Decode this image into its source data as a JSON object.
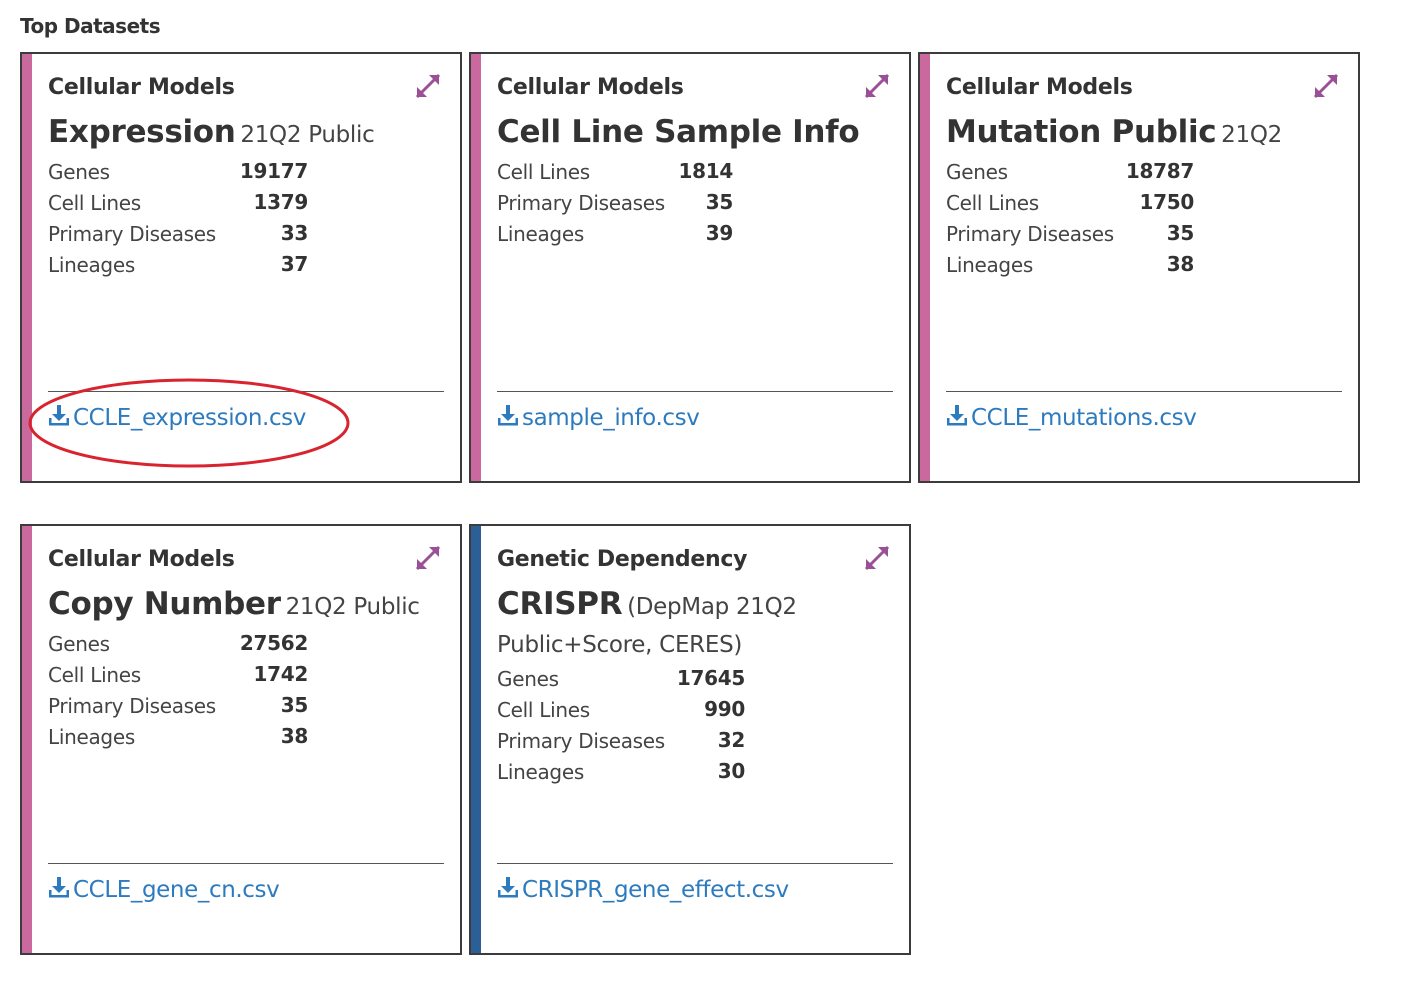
{
  "section_title": "Top Datasets",
  "colors": {
    "cellular_accent": "#c9699e",
    "genetic_accent": "#2c5f96",
    "link": "#2d7bbf",
    "expand_icon": "#9b4f96",
    "highlight": "#d9242f"
  },
  "cards": [
    {
      "category": "Cellular Models",
      "name": "Expression",
      "subtitle": "21Q2 Public",
      "stats": [
        {
          "label": "Genes",
          "value": "19177"
        },
        {
          "label": "Cell Lines",
          "value": "1379"
        },
        {
          "label": "Primary Diseases",
          "value": "33"
        },
        {
          "label": "Lineages",
          "value": "37"
        }
      ],
      "file": "CCLE_expression.csv",
      "highlighted": true
    },
    {
      "category": "Cellular Models",
      "name": "Cell Line Sample Info",
      "subtitle": "",
      "stats": [
        {
          "label": "Cell Lines",
          "value": "1814"
        },
        {
          "label": "Primary Diseases",
          "value": "35"
        },
        {
          "label": "Lineages",
          "value": "39"
        }
      ],
      "file": "sample_info.csv"
    },
    {
      "category": "Cellular Models",
      "name": "Mutation Public",
      "subtitle": "21Q2",
      "stats": [
        {
          "label": "Genes",
          "value": "18787"
        },
        {
          "label": "Cell Lines",
          "value": "1750"
        },
        {
          "label": "Primary Diseases",
          "value": "35"
        },
        {
          "label": "Lineages",
          "value": "38"
        }
      ],
      "file": "CCLE_mutations.csv"
    },
    {
      "category": "Cellular Models",
      "name": "Copy Number",
      "subtitle": "21Q2 Public",
      "stats": [
        {
          "label": "Genes",
          "value": "27562"
        },
        {
          "label": "Cell Lines",
          "value": "1742"
        },
        {
          "label": "Primary Diseases",
          "value": "35"
        },
        {
          "label": "Lineages",
          "value": "38"
        }
      ],
      "file": "CCLE_gene_cn.csv"
    },
    {
      "category": "Genetic Dependency",
      "name": "CRISPR",
      "subtitle": "(DepMap 21Q2 Public+Score, CERES)",
      "stats": [
        {
          "label": "Genes",
          "value": "17645"
        },
        {
          "label": "Cell Lines",
          "value": "990"
        },
        {
          "label": "Primary Diseases",
          "value": "32"
        },
        {
          "label": "Lineages",
          "value": "30"
        }
      ],
      "file": "CRISPR_gene_effect.csv"
    }
  ]
}
